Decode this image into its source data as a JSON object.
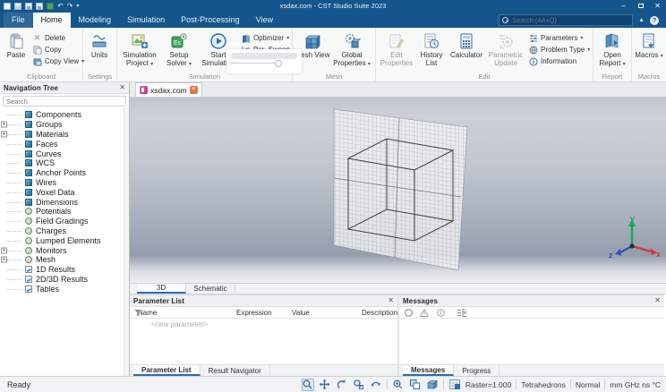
{
  "window": {
    "title": "xsdax.com - CST Studio Suite 2023"
  },
  "titlebar": {
    "search_placeholder": "Search (Alt+Q)",
    "help": "?"
  },
  "menu": {
    "tabs": [
      {
        "label": "File",
        "cls": "file"
      },
      {
        "label": "Home",
        "cls": "active"
      },
      {
        "label": "Modeling",
        "cls": ""
      },
      {
        "label": "Simulation",
        "cls": ""
      },
      {
        "label": "Post-Processing",
        "cls": ""
      },
      {
        "label": "View",
        "cls": ""
      }
    ]
  },
  "ribbon": {
    "clipboard": {
      "group": "Clipboard",
      "paste": "Paste",
      "delete": "Delete",
      "copy": "Copy",
      "copy_view": "Copy View"
    },
    "settings": {
      "group": "Settings",
      "units": "Units"
    },
    "simulation": {
      "group": "Simulation",
      "project": "Simulation Project",
      "solver": "Setup Solver",
      "start": "Start Simulation",
      "optimizer": "Optimizer",
      "par_sweep": "Par. Sweep"
    },
    "mesh": {
      "group": "Mesh",
      "mesh_view": "Mesh View",
      "global_properties": "Global Properties"
    },
    "edit": {
      "group": "Edit",
      "edit_properties": "Edit Properties",
      "history_list": "History List",
      "calculator": "Calculator",
      "parametric_update": "Parametric Update",
      "parameters": "Parameters",
      "problem_type": "Problem Type",
      "information": "Information"
    },
    "report": {
      "group": "Report",
      "open_report": "Open Report"
    },
    "macros": {
      "group": "Macros",
      "macros": "Macros"
    }
  },
  "nav_tree": {
    "title": "Navigation Tree",
    "search_placeholder": "Search",
    "items": [
      {
        "label": "Components",
        "icon": "cube",
        "cls": ""
      },
      {
        "label": "Groups",
        "icon": "cube",
        "cls": "exp"
      },
      {
        "label": "Materials",
        "icon": "cube",
        "cls": "exp"
      },
      {
        "label": "Faces",
        "icon": "cube",
        "cls": ""
      },
      {
        "label": "Curves",
        "icon": "cube",
        "cls": ""
      },
      {
        "label": "WCS",
        "icon": "cube",
        "cls": ""
      },
      {
        "label": "Anchor Points",
        "icon": "cube",
        "cls": ""
      },
      {
        "label": "Wires",
        "icon": "cube",
        "cls": ""
      },
      {
        "label": "Voxel Data",
        "icon": "cube",
        "cls": ""
      },
      {
        "label": "Dimensions",
        "icon": "cube",
        "cls": ""
      },
      {
        "label": "Potentials",
        "icon": "circle",
        "cls": ""
      },
      {
        "label": "Field Gradings",
        "icon": "circle",
        "cls": ""
      },
      {
        "label": "Charges",
        "icon": "circle",
        "cls": ""
      },
      {
        "label": "Lumped Elements",
        "icon": "circle",
        "cls": ""
      },
      {
        "label": "Monitors",
        "icon": "circle",
        "cls": "exp"
      },
      {
        "label": "Mesh",
        "icon": "circle",
        "cls": "exp"
      },
      {
        "label": "1D Results",
        "icon": "chart",
        "cls": ""
      },
      {
        "label": "2D/3D Results",
        "icon": "chart",
        "cls": ""
      },
      {
        "label": "Tables",
        "icon": "chart",
        "cls": ""
      }
    ]
  },
  "doc_tab": {
    "label": "xsdax.com"
  },
  "view_tabs": [
    {
      "label": "3D",
      "cls": "active"
    },
    {
      "label": "Schematic",
      "cls": ""
    }
  ],
  "parameter_list": {
    "title": "Parameter List",
    "columns": [
      "Name",
      "Expression",
      "Value",
      "Description"
    ],
    "new_row": "<new parameter>",
    "tabs": [
      {
        "label": "Parameter List",
        "cls": "active"
      },
      {
        "label": "Result Navigator",
        "cls": ""
      }
    ]
  },
  "messages": {
    "title": "Messages",
    "tabs": [
      {
        "label": "Messages",
        "cls": "active"
      },
      {
        "label": "Progress",
        "cls": ""
      }
    ]
  },
  "axes": {
    "x": "x",
    "y": "y",
    "z": "z"
  },
  "status": {
    "ready": "Ready",
    "raster": "Raster=1.000",
    "mesh": "Tetrahedrons",
    "mode": "Normal",
    "units": "mm GHz ns °C"
  },
  "colors": {
    "accent_blue": "#14568c",
    "tab_active": "#2b6cb5",
    "axis_x": "#d23b3b",
    "axis_y": "#0faf4e",
    "axis_z": "#2b53c0"
  }
}
